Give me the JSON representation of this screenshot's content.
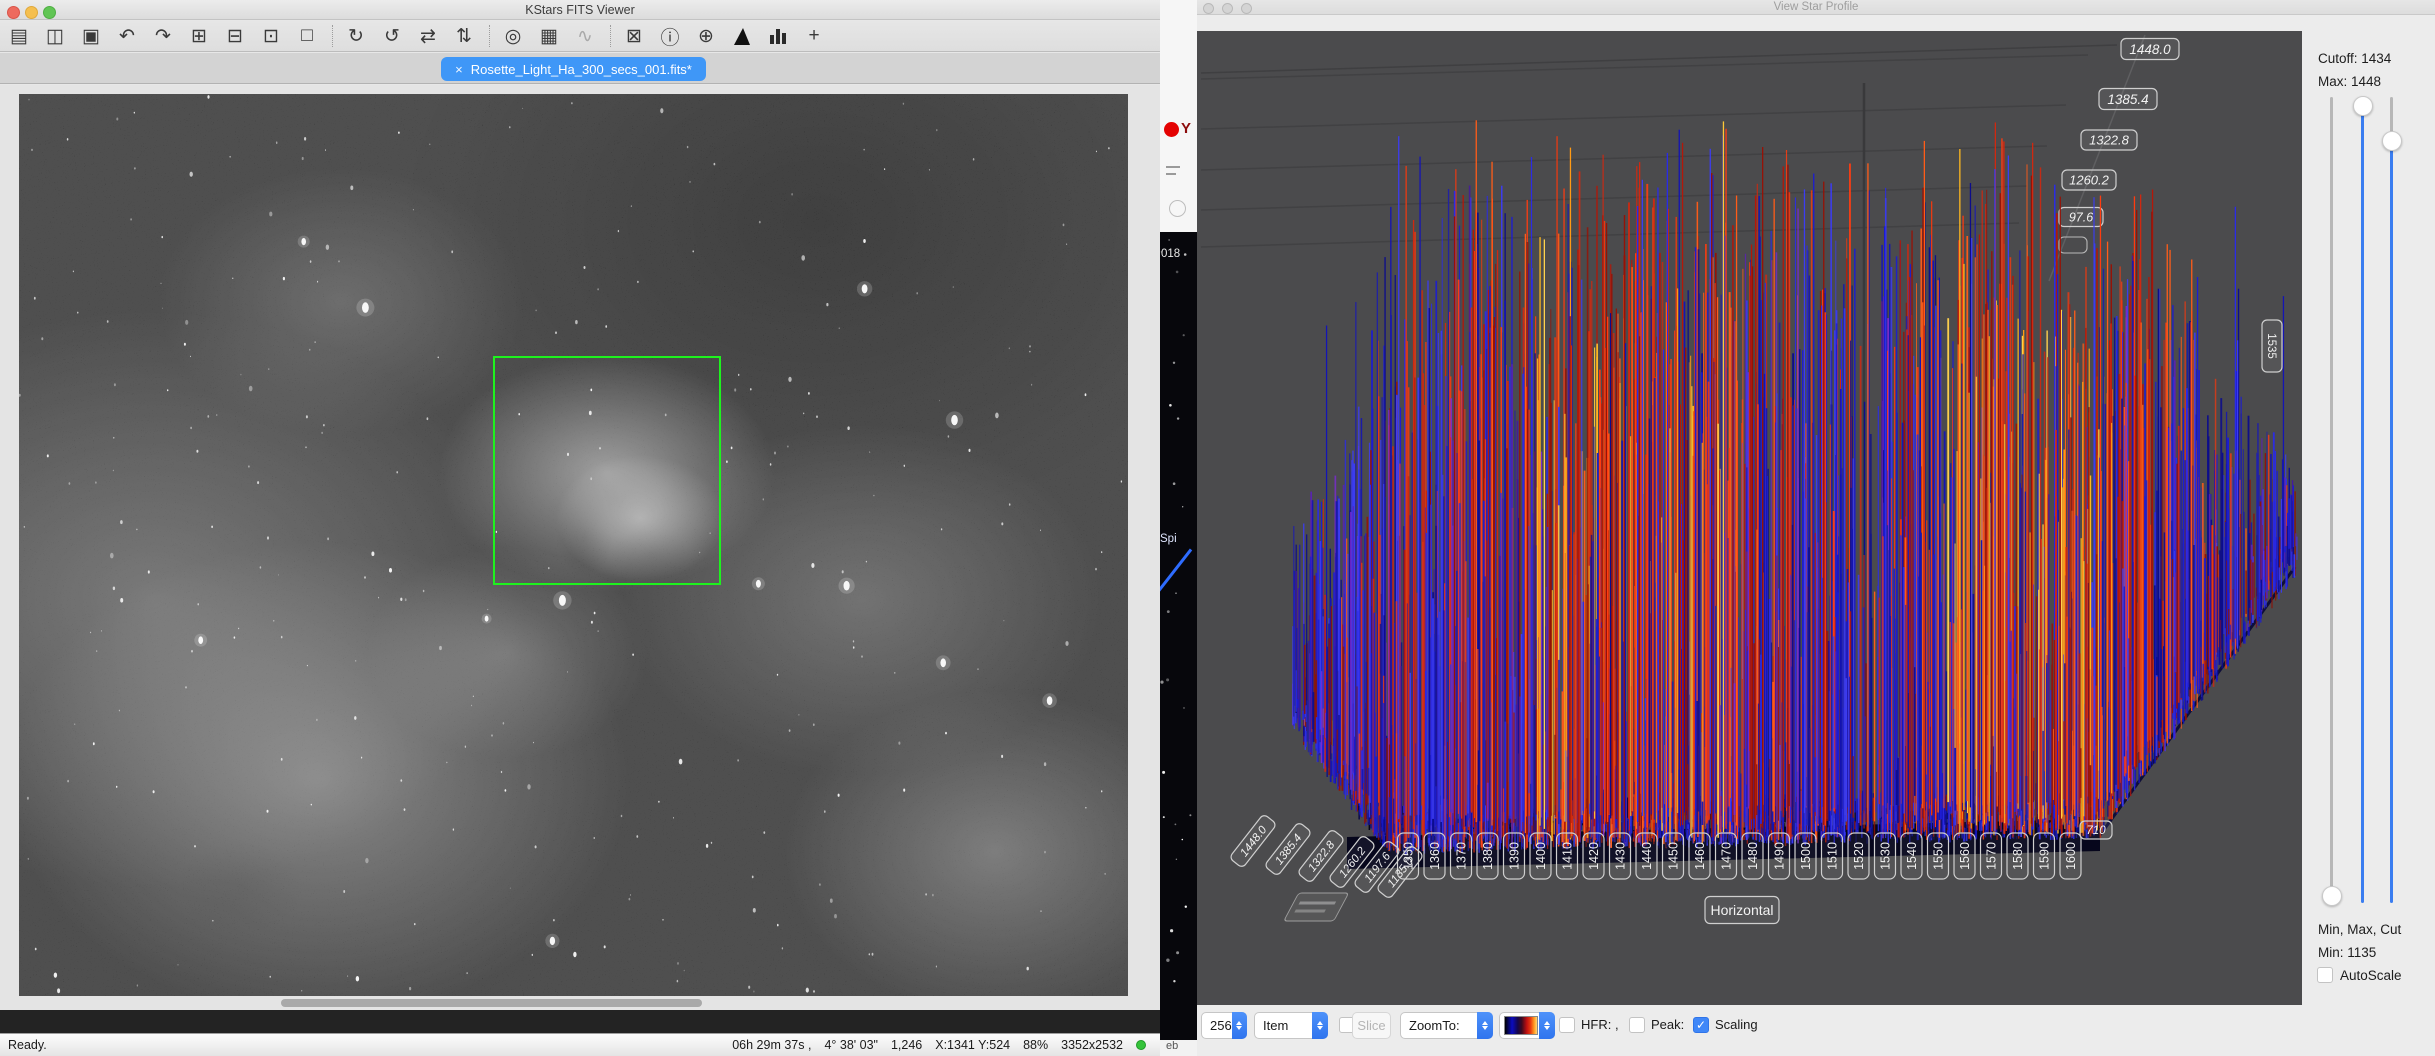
{
  "chart_data": {
    "type": "3d-spike-histogram",
    "title": "View Star Profile",
    "description": "3D pixel-intensity spike plot of a star region: dense dark-blue base plane with two tall red/orange lobes with yellow cores separated by a narrow central seam; blue spikes elsewhere.",
    "x_axis": {
      "label": "Horizontal",
      "ticks": [
        "1350",
        "1360",
        "1370",
        "1380",
        "1390",
        "1400",
        "1410",
        "1420",
        "1430",
        "1440",
        "1450",
        "1460",
        "1470",
        "1480",
        "1490",
        "1500",
        "1510",
        "1520",
        "1530",
        "1540",
        "1550",
        "1560",
        "1570",
        "1580",
        "1590",
        "1600"
      ]
    },
    "depth_axis": {
      "ticks": [
        "1448.0",
        "1385.4",
        "1322.8",
        "1260.2",
        "1197.6",
        "1135.0"
      ]
    },
    "value_axis": {
      "range": [
        1135,
        1448
      ],
      "wall_ticks_visible": [
        "1448.0",
        "1385.4",
        "1322.8",
        "1260.2",
        "97.6"
      ]
    },
    "corner_tick": "710",
    "right_wall_tick": "1535",
    "cutoff": 1434,
    "max": 1448,
    "min": 1135,
    "sample_size": 256,
    "colormap": [
      "#000000",
      "#1a1ac8",
      "#d02010",
      "#ff9a20",
      "#ffd24d"
    ],
    "plot_background": "#4b4b4d"
  },
  "left_window": {
    "title": "KStars FITS Viewer",
    "traffic_light_colors": [
      "#ed6a5e",
      "#f5bf4f",
      "#61c554"
    ],
    "toolbar_icons": [
      {
        "name": "open-file-icon",
        "glyph": "▤"
      },
      {
        "name": "save-file-icon",
        "glyph": "◫"
      },
      {
        "name": "save-file-as-icon",
        "glyph": "▣"
      },
      {
        "name": "undo-icon",
        "glyph": "↶"
      },
      {
        "name": "redo-icon",
        "glyph": "↷"
      },
      {
        "name": "zoom-in-icon",
        "glyph": "⊞"
      },
      {
        "name": "zoom-out-icon",
        "glyph": "⊟"
      },
      {
        "name": "zoom-to-fit-icon",
        "glyph": "⊡"
      },
      {
        "name": "zoom-actual-size-icon",
        "glyph": "□"
      },
      {
        "name": "separator"
      },
      {
        "name": "rotate-right-icon",
        "glyph": "↻"
      },
      {
        "name": "rotate-left-icon",
        "glyph": "↺"
      },
      {
        "name": "flip-horizontal-icon",
        "glyph": "⇄"
      },
      {
        "name": "flip-vertical-icon",
        "glyph": "⇅"
      },
      {
        "name": "separator"
      },
      {
        "name": "mark-stars-icon",
        "glyph": "◎"
      },
      {
        "name": "pixel-grid-icon",
        "glyph": "▦"
      },
      {
        "name": "statistics-icon",
        "glyph": "∿",
        "dim": true
      },
      {
        "name": "separator"
      },
      {
        "name": "toggle-stars-icon",
        "glyph": "⊠"
      },
      {
        "name": "fits-header-icon",
        "glyph": "ⓘ"
      },
      {
        "name": "center-telescope-icon",
        "glyph": "⊕"
      },
      {
        "name": "histogram-icon",
        "type": "mountain"
      },
      {
        "name": "star-profile-icon",
        "type": "bars"
      },
      {
        "name": "pan-icon",
        "glyph": "+"
      }
    ],
    "tab": {
      "close_glyph": "×",
      "label": "Rosette_Light_Ha_300_secs_001.fits*"
    },
    "status": {
      "ready": "Ready.",
      "ra": "06h 29m 37s ,",
      "dec": "4° 38' 03\"",
      "pixel_value": "1,246",
      "xy": "X:1341 Y:524",
      "zoom": "88%",
      "resolution": "3352x2532"
    }
  },
  "background_strip": {
    "text_018": "018",
    "text_spi": "Spi",
    "text_eb": "eb",
    "logo_y": "Y"
  },
  "right_window": {
    "title": "View Star Profile",
    "sidebar": {
      "cutoff_label": "Cutoff: 1434",
      "max_label": "Max: 1448",
      "minmaxcut_label": "Min, Max, Cut",
      "min_label": "Min: 1135",
      "autoscale_label": "AutoScale",
      "check_glyph": "✓"
    },
    "toolbar": {
      "sample_value": "256",
      "item_value": "Item",
      "slice_label": "Slice",
      "zoomto_value": "ZoomTo:",
      "hfr_label": "HFR:",
      "comma": ",",
      "peak_label": "Peak:",
      "scaling_label": "Scaling",
      "check_glyph": "✓"
    }
  }
}
